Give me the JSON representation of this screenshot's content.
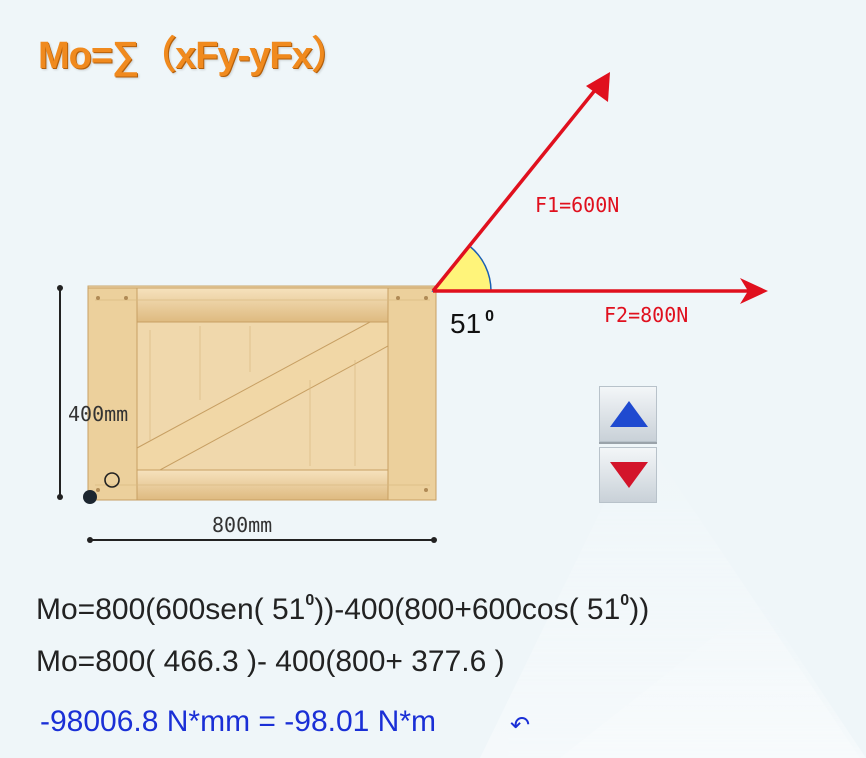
{
  "header": {
    "formula": "Mo=∑（xFy-yFx）"
  },
  "diagram": {
    "force1_label": "F1=600N",
    "force2_label": "F2=800N",
    "angle_value": "51",
    "angle_exponent": "0",
    "height_label": "400mm",
    "width_label": "800mm",
    "origin_label": "O"
  },
  "controls": {
    "up_icon": "triangle-up-icon",
    "down_icon": "triangle-down-icon"
  },
  "calculation": {
    "line1_a": "Mo=800(600sen( 51",
    "line1_b": "0",
    "line1_c": "))-400(800+600cos( 51",
    "line1_d": "0",
    "line1_e": "))",
    "line2": "Mo=800( 466.3 )- 400(800+ 377.6 )",
    "result": "-98006.8 N*mm = -98.01 N*m",
    "rotation_icon": "counterclockwise-arrow-icon"
  },
  "colors": {
    "formula": "#f08a1e",
    "force_vector": "#e0101e",
    "result": "#1a2fd6",
    "angle_fill": "#fff47a"
  }
}
